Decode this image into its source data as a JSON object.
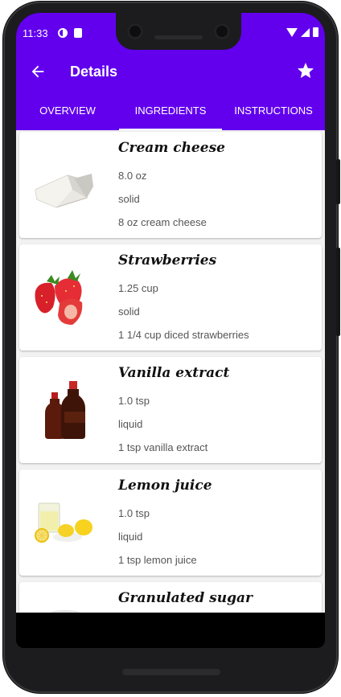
{
  "status_bar": {
    "time": "11:33"
  },
  "app_bar": {
    "title": "Details"
  },
  "tabs": [
    {
      "label": "OVERVIEW"
    },
    {
      "label": "INGREDIENTS",
      "active": true
    },
    {
      "label": "INSTRUCTIONS"
    }
  ],
  "ingredients": [
    {
      "name": "Cream cheese",
      "amount": "8.0  oz",
      "state": "solid",
      "description": "8 oz cream cheese",
      "image_icon": "cream-cheese-image"
    },
    {
      "name": "Strawberries",
      "amount": "1.25  cup",
      "state": "solid",
      "description": "1 1/4 cup diced strawberries",
      "image_icon": "strawberries-image"
    },
    {
      "name": "Vanilla extract",
      "amount": "1.0  tsp",
      "state": "liquid",
      "description": "1 tsp vanilla extract",
      "image_icon": "vanilla-extract-image"
    },
    {
      "name": "Lemon juice",
      "amount": "1.0  tsp",
      "state": "liquid",
      "description": "1 tsp lemon juice",
      "image_icon": "lemon-juice-image"
    },
    {
      "name": "Granulated sugar",
      "amount": "",
      "state": "",
      "description": "",
      "image_icon": "sugar-image"
    }
  ],
  "colors": {
    "primary": "#6200ee",
    "background": "#f2f2f2",
    "card": "#ffffff"
  }
}
